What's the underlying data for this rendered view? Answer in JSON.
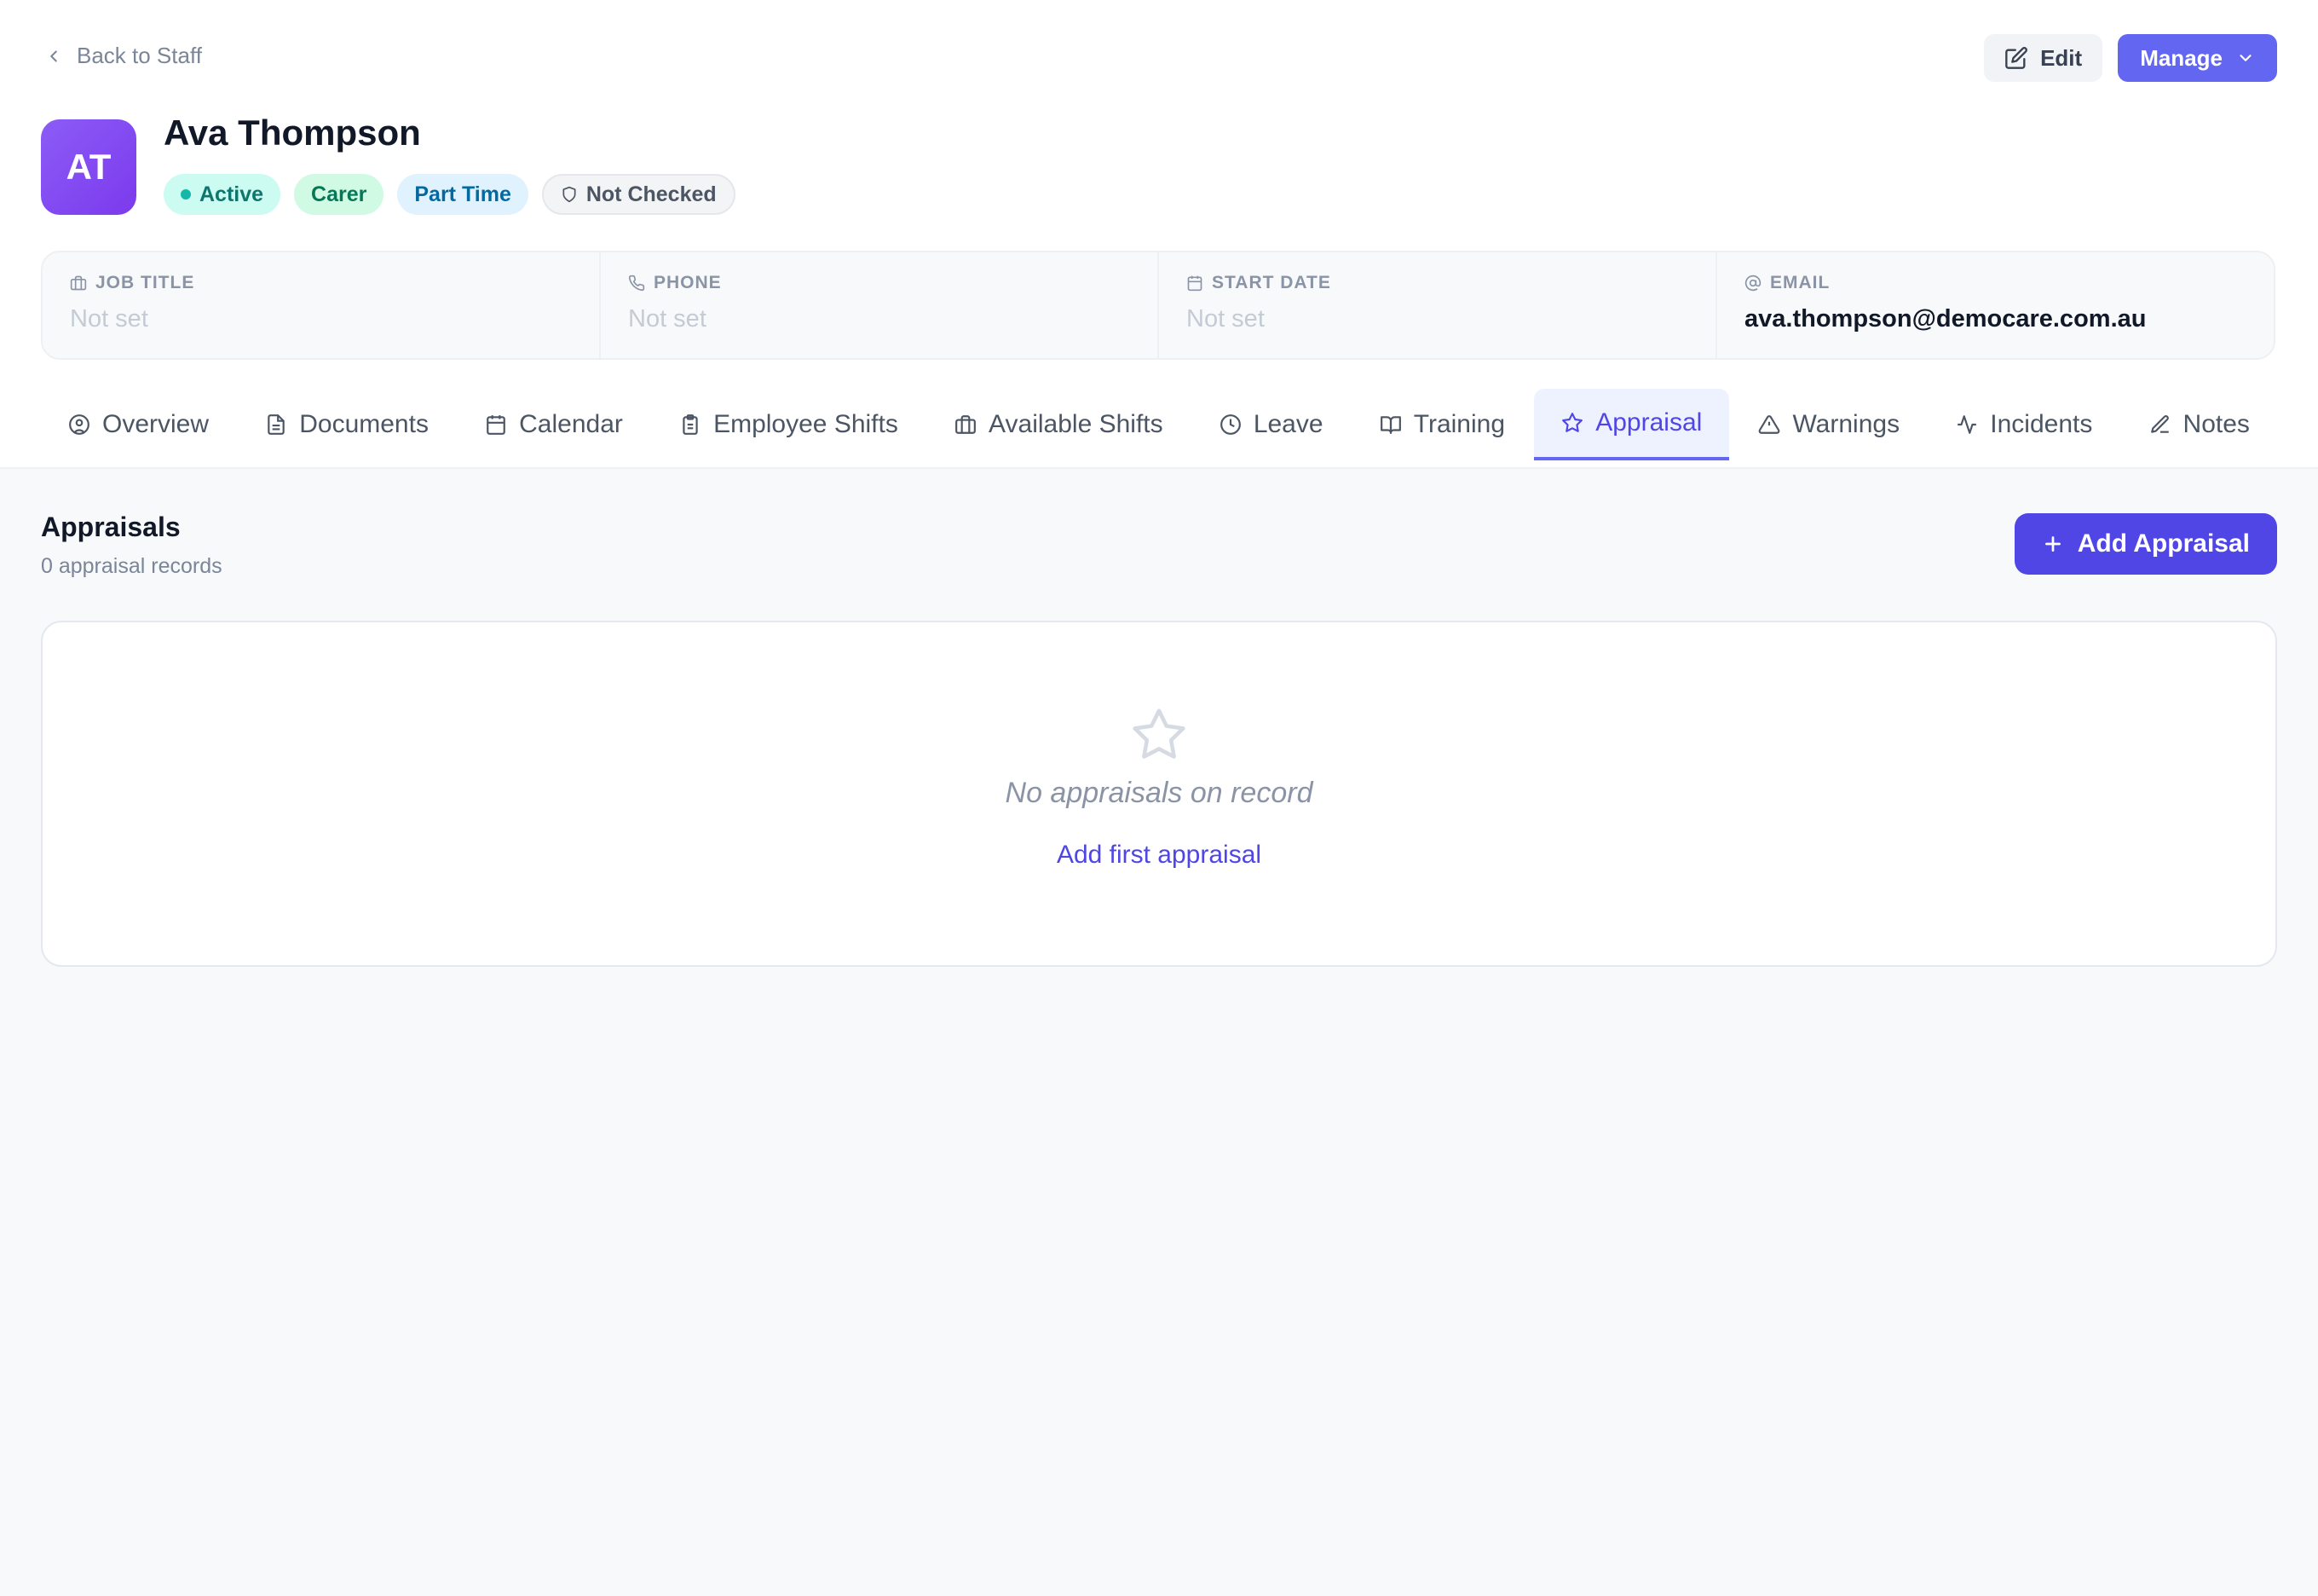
{
  "header": {
    "back_label": "Back to Staff",
    "edit_label": "Edit",
    "manage_label": "Manage"
  },
  "profile": {
    "initials": "AT",
    "name": "Ava Thompson",
    "badges": {
      "status": "Active",
      "role": "Carer",
      "employment": "Part Time",
      "check": "Not Checked"
    }
  },
  "info": {
    "job_title": {
      "label": "JOB TITLE",
      "value": "Not set"
    },
    "phone": {
      "label": "PHONE",
      "value": "Not set"
    },
    "start_date": {
      "label": "START DATE",
      "value": "Not set"
    },
    "email": {
      "label": "EMAIL",
      "value": "ava.thompson@democare.com.au"
    }
  },
  "tabs": [
    {
      "label": "Overview",
      "icon": "user-circle-icon"
    },
    {
      "label": "Documents",
      "icon": "document-icon"
    },
    {
      "label": "Calendar",
      "icon": "calendar-icon"
    },
    {
      "label": "Employee Shifts",
      "icon": "clipboard-icon"
    },
    {
      "label": "Available Shifts",
      "icon": "briefcase-icon"
    },
    {
      "label": "Leave",
      "icon": "clock-icon"
    },
    {
      "label": "Training",
      "icon": "book-icon"
    },
    {
      "label": "Appraisal",
      "icon": "star-icon",
      "active": true
    },
    {
      "label": "Warnings",
      "icon": "warning-icon"
    },
    {
      "label": "Incidents",
      "icon": "activity-icon"
    },
    {
      "label": "Notes",
      "icon": "pencil-icon"
    }
  ],
  "section": {
    "title": "Appraisals",
    "subtitle": "0 appraisal records",
    "add_label": "Add Appraisal"
  },
  "empty": {
    "message": "No appraisals on record",
    "link": "Add first appraisal"
  },
  "colors": {
    "accent": "#4f46e5",
    "accent_light": "#6366f1",
    "active_badge": "#ccfbf1",
    "carer_badge": "#d1fae5",
    "part_time_badge": "#e0f2fe"
  }
}
